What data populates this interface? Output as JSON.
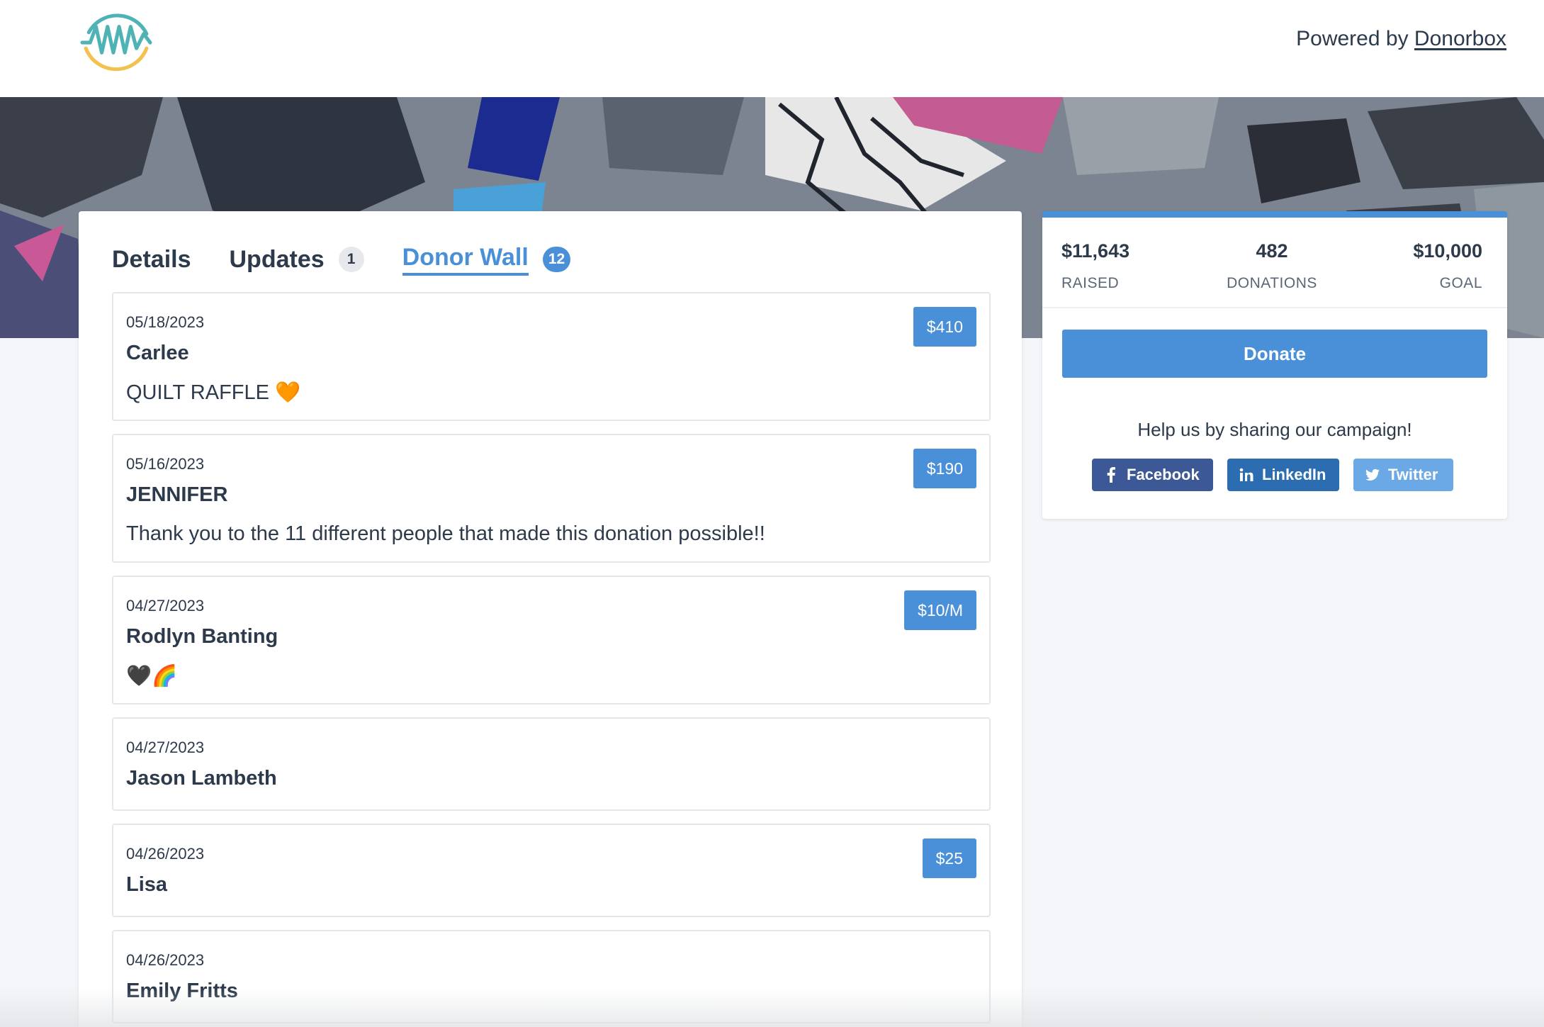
{
  "header": {
    "powered_prefix": "Powered by",
    "powered_link": "Donorbox"
  },
  "tabs": [
    {
      "label": "Details",
      "count": null
    },
    {
      "label": "Updates",
      "count": "1"
    },
    {
      "label": "Donor Wall",
      "count": "12"
    }
  ],
  "donations": [
    {
      "date": "05/18/2023",
      "name": "Carlee",
      "message": "QUILT RAFFLE 🧡",
      "amount": "$410"
    },
    {
      "date": "05/16/2023",
      "name": "JENNIFER",
      "message": "Thank you to the 11 different people that made this donation possible!!",
      "amount": "$190"
    },
    {
      "date": "04/27/2023",
      "name": "Rodlyn Banting",
      "message": "🖤🌈",
      "amount": "$10/M"
    },
    {
      "date": "04/27/2023",
      "name": "Jason Lambeth",
      "message": "",
      "amount": ""
    },
    {
      "date": "04/26/2023",
      "name": "Lisa",
      "message": "",
      "amount": "$25"
    },
    {
      "date": "04/26/2023",
      "name": "Emily Fritts",
      "message": "",
      "amount": ""
    }
  ],
  "stats": {
    "raised_value": "$11,643",
    "raised_label": "RAISED",
    "donations_value": "482",
    "donations_label": "DONATIONS",
    "goal_value": "$10,000",
    "goal_label": "GOAL"
  },
  "donate_label": "Donate",
  "share_text": "Help us by sharing our campaign!",
  "share": {
    "facebook": "Facebook",
    "linkedin": "LinkedIn",
    "twitter": "Twitter"
  },
  "colors": {
    "accent": "#4a90d9",
    "facebook": "#3c5896",
    "linkedin": "#2c6cb0",
    "twitter": "#6aa9e6",
    "text": "#2c3a4b"
  },
  "icons": [
    "org-logo-icon",
    "facebook-icon",
    "linkedin-icon",
    "twitter-icon"
  ]
}
